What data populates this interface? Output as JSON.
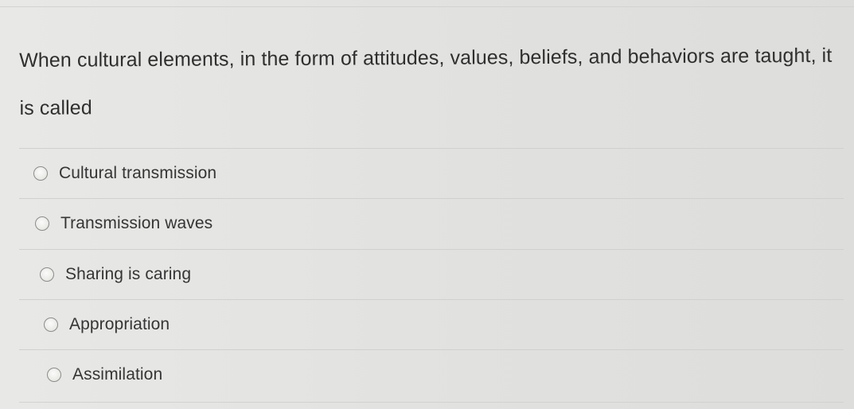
{
  "question": {
    "text": "When cultural elements, in the form of attitudes, values, beliefs, and behaviors are taught, it is called"
  },
  "answers": [
    {
      "label": "Cultural transmission"
    },
    {
      "label": "Transmission waves"
    },
    {
      "label": "Sharing is caring"
    },
    {
      "label": "Appropriation"
    },
    {
      "label": "Assimilation"
    }
  ],
  "colors": {
    "background": "#e3e3e1",
    "text": "#2f2f2f",
    "divider": "#d0d0ce",
    "radio_border": "#8c8c8a"
  },
  "icons": {
    "radio": "radio-button-icon"
  }
}
